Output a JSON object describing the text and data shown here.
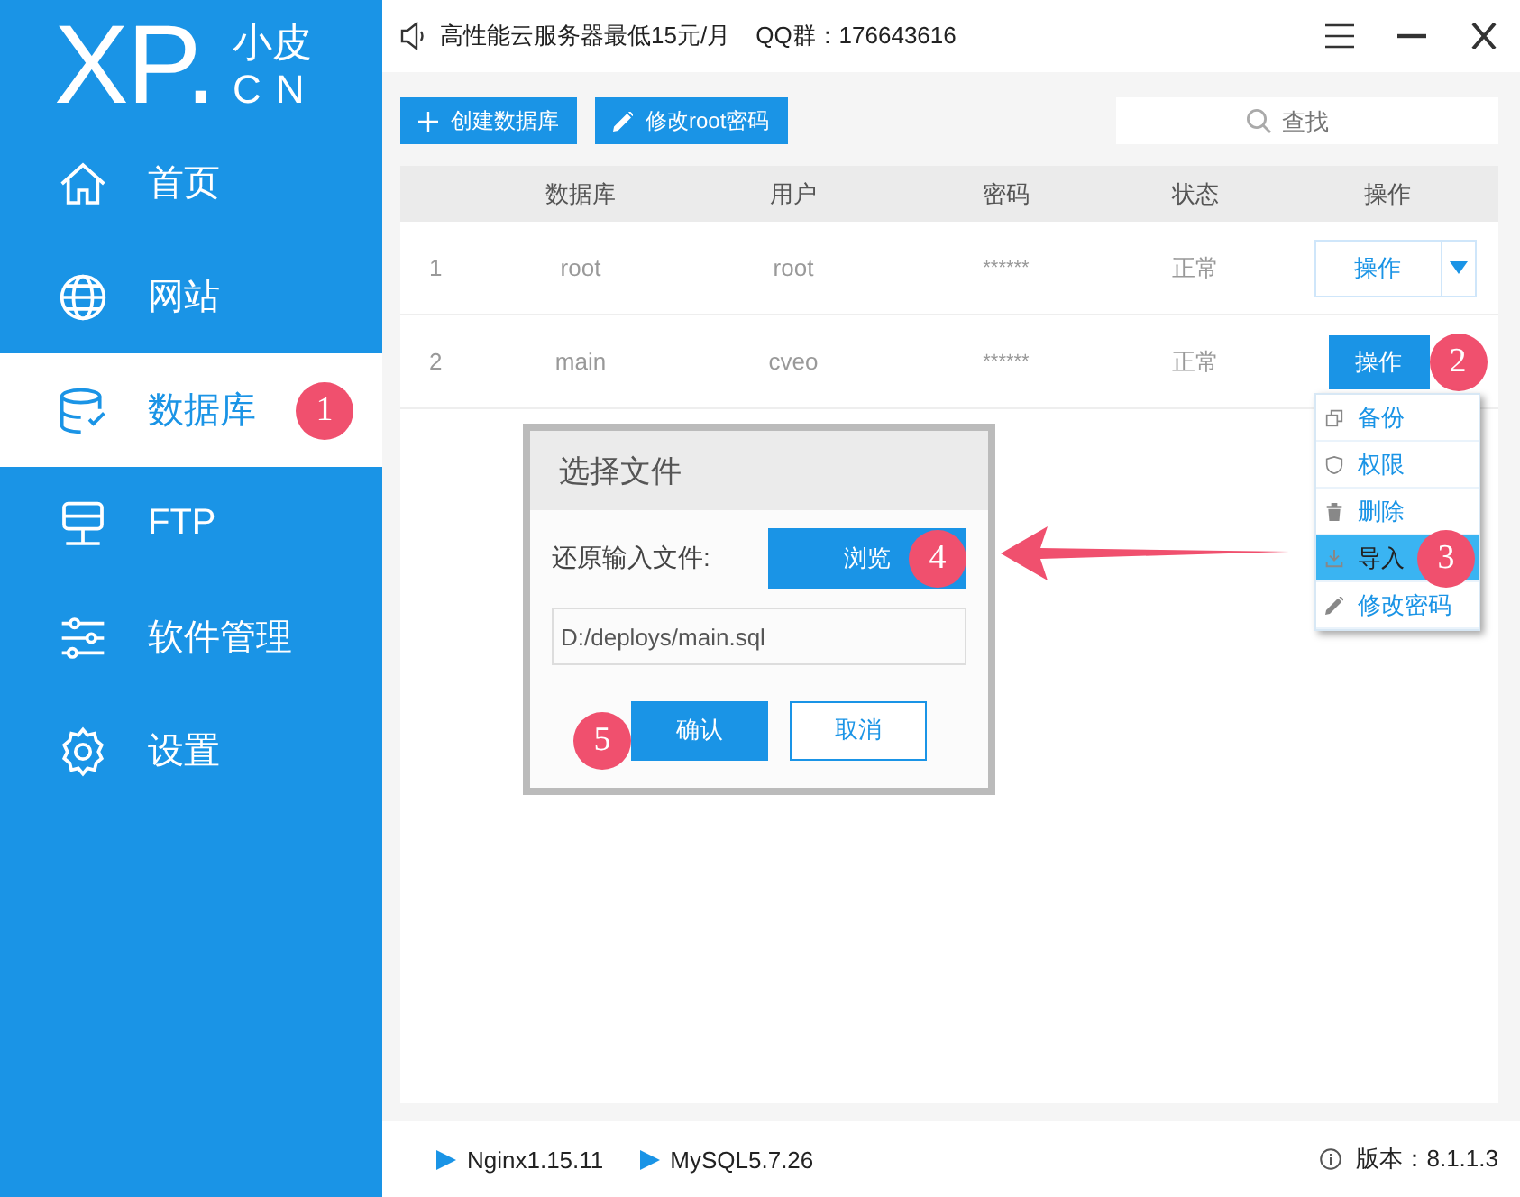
{
  "logo": {
    "mark": "XP.",
    "top": "小皮",
    "bottom": "CN"
  },
  "sidebar": {
    "items": [
      {
        "label": "首页",
        "selected": false
      },
      {
        "label": "网站",
        "selected": false
      },
      {
        "label": "数据库",
        "selected": true,
        "badge": "1"
      },
      {
        "label": "FTP",
        "selected": false
      },
      {
        "label": "软件管理",
        "selected": false
      },
      {
        "label": "设置",
        "selected": false
      }
    ]
  },
  "top_bar": {
    "notice": "高性能云服务器最低15元/月",
    "qq": "QQ群：176643616"
  },
  "toolbar": {
    "buttons": [
      {
        "label": "创建数据库"
      },
      {
        "label": "修改root密码"
      }
    ],
    "search": {
      "placeholder": "查找"
    }
  },
  "table": {
    "columns": [
      "数据库",
      "用户",
      "密码",
      "状态",
      "操作"
    ],
    "rows": [
      {
        "index": "1",
        "database": "root",
        "user": "root",
        "password": "******",
        "status": "正常",
        "action": "操作",
        "selected": false
      },
      {
        "index": "2",
        "database": "main",
        "user": "cveo",
        "password": "******",
        "status": "正常",
        "action": "操作",
        "selected": true,
        "badge": "2"
      }
    ]
  },
  "action_menu": {
    "items": [
      {
        "label": "备份",
        "selected": false
      },
      {
        "label": "权限",
        "selected": false
      },
      {
        "label": "删除",
        "selected": false
      },
      {
        "label": "导入",
        "selected": true,
        "badge": "3"
      },
      {
        "label": "修改密码",
        "selected": false
      }
    ]
  },
  "dialog": {
    "title": "选择文件",
    "label": "还原输入文件:",
    "browse": {
      "label": "浏览",
      "badge": "4"
    },
    "file": {
      "value": "D:/deploys/main.sql"
    },
    "confirm": {
      "label": "确认",
      "badge": "5"
    },
    "cancel": {
      "label": "取消"
    }
  },
  "status_bar": {
    "services": [
      "Nginx1.15.11",
      "MySQL5.7.26"
    ],
    "version": "版本：8.1.1.3"
  }
}
